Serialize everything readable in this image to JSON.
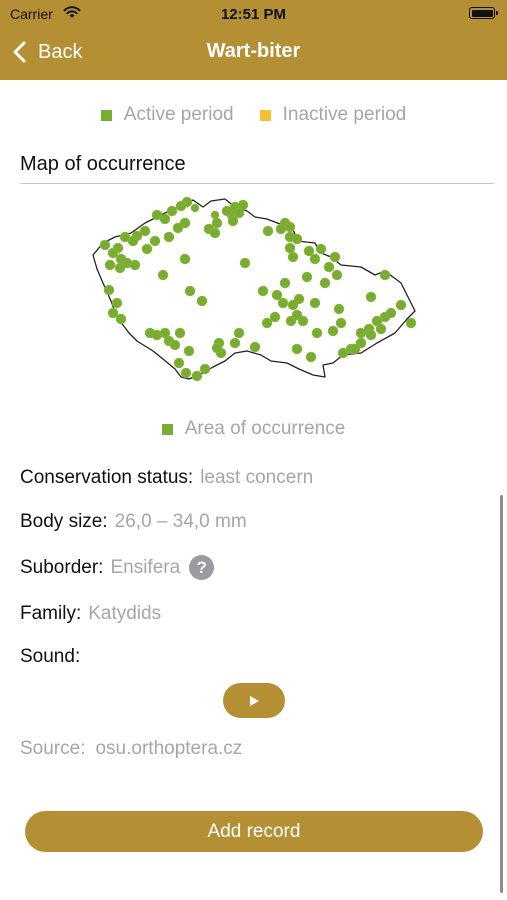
{
  "status_bar": {
    "carrier": "Carrier",
    "time": "12:51 PM"
  },
  "nav": {
    "back_label": "Back",
    "title": "Wart-biter"
  },
  "period_legend": [
    {
      "label": "Active period",
      "color": "#7aab32"
    },
    {
      "label": "Inactive period",
      "color": "#f2c232"
    }
  ],
  "map_section": {
    "title": "Map of occurrence",
    "legend_label": "Area of occurrence",
    "legend_color": "#7aab32"
  },
  "details": {
    "conservation_key": "Conservation status:",
    "conservation_value": "least concern",
    "body_size_key": "Body size:",
    "body_size_value": "26,0 – 34,0 mm",
    "suborder_key": "Suborder:",
    "suborder_value": "Ensifera",
    "family_key": "Family:",
    "family_value": "Katydids",
    "sound_key": "Sound:"
  },
  "source": {
    "label": "Source:",
    "value": "osu.orthoptera.cz"
  },
  "actions": {
    "add_record": "Add record"
  },
  "colors": {
    "accent": "#b48f34",
    "occurrence": "#7aab32",
    "inactive": "#f2c232"
  },
  "icons": {
    "back": "chevron-left-icon",
    "help": "question-icon",
    "play": "play-icon",
    "wifi": "wifi-icon",
    "battery": "battery-icon"
  }
}
